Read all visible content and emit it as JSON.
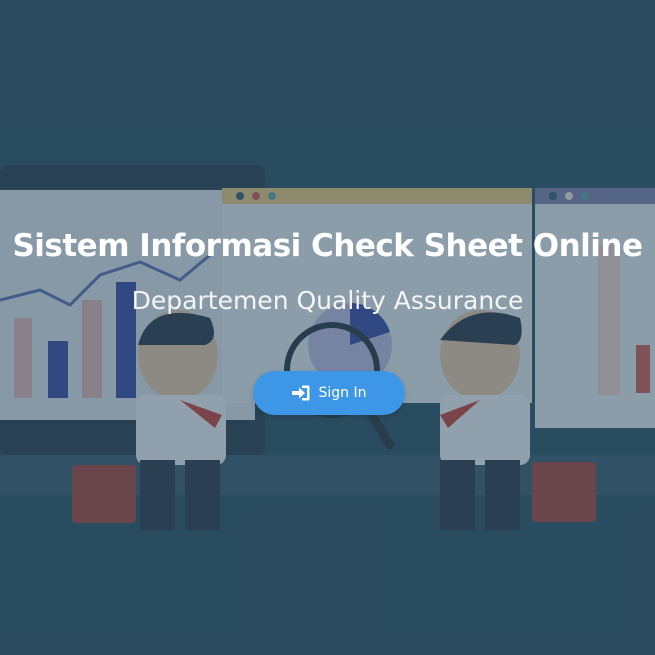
{
  "hero": {
    "title": "Sistem Informasi Check Sheet Online",
    "subtitle": "Departemen Quality Assurance"
  },
  "signin": {
    "label": "Sign In",
    "icon": "sign-in-icon"
  },
  "colors": {
    "background": "#2f4f63",
    "button": "#3d97e6",
    "text": "#ffffff"
  }
}
